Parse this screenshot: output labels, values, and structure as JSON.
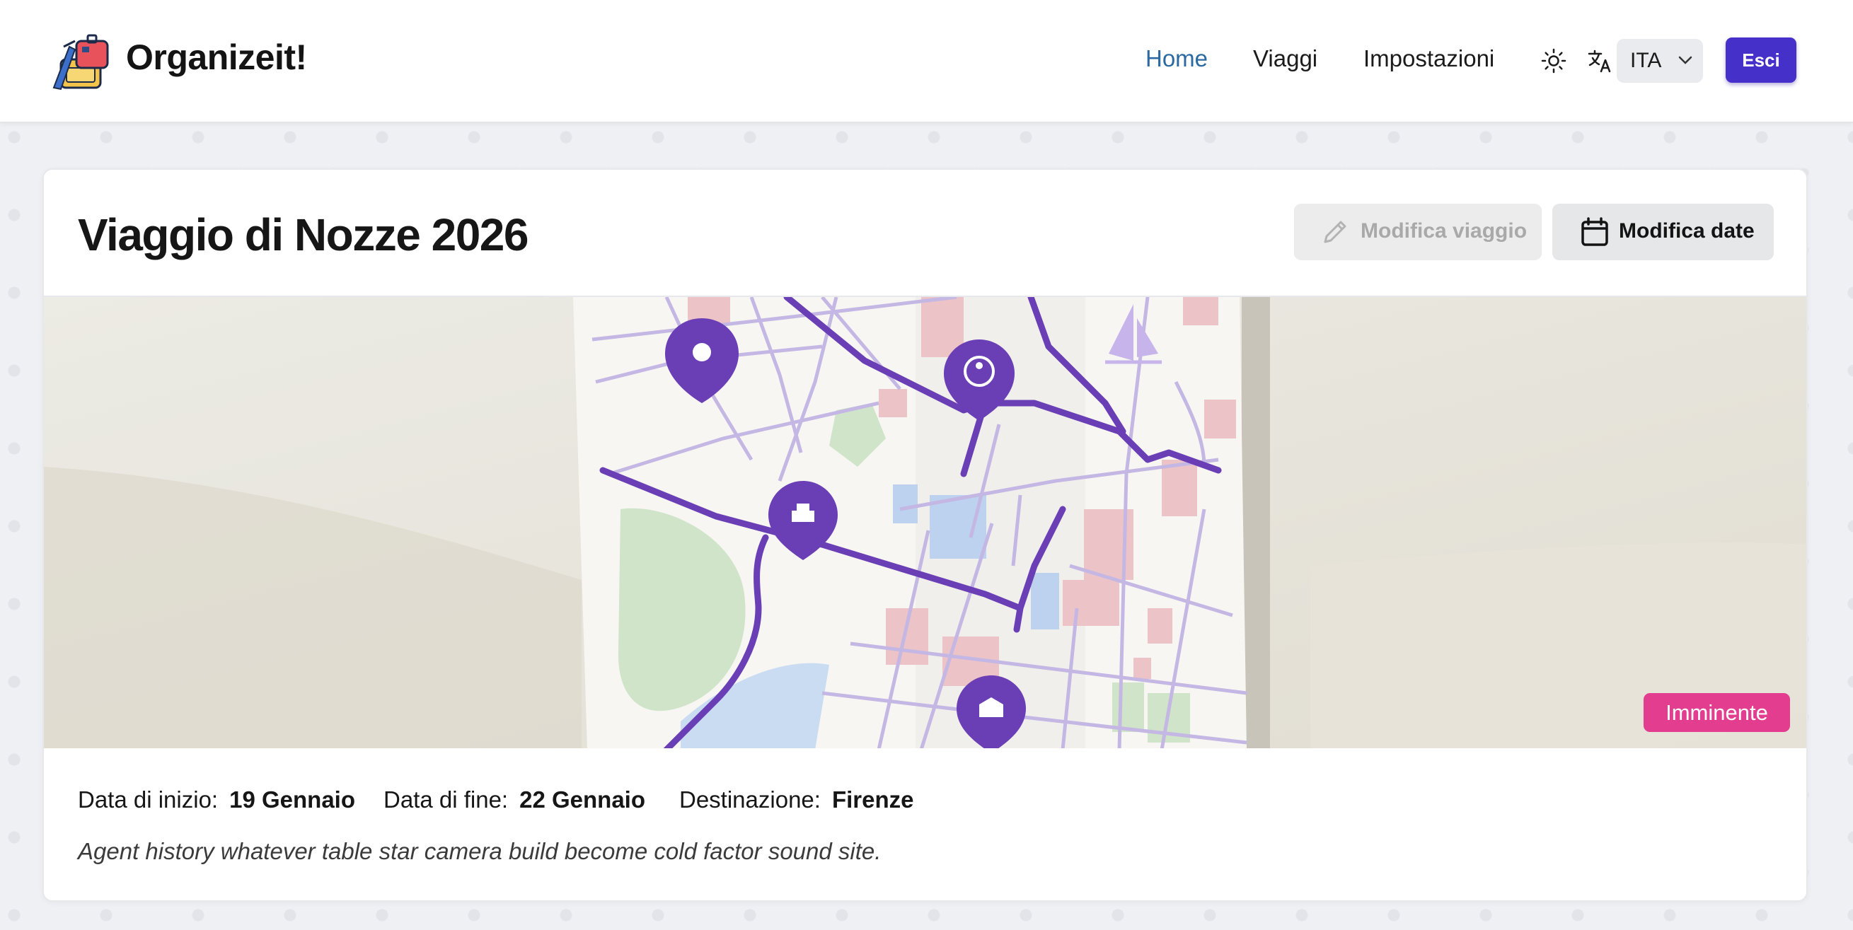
{
  "header": {
    "brand": "Organizeit!",
    "nav": [
      {
        "label": "Home",
        "active": true
      },
      {
        "label": "Viaggi",
        "active": false
      },
      {
        "label": "Impostazioni",
        "active": false
      }
    ],
    "theme_icon": "sun-icon",
    "translate_icon": "translate-icon",
    "language": "ITA",
    "logout_label": "Esci"
  },
  "trip": {
    "title": "Viaggio di Nozze 2026",
    "edit_trip_label": "Modifica viaggio",
    "edit_dates_label": "Modifica date",
    "status": "Imminente",
    "start_label": "Data di inizio:",
    "start_value": "19 Gennaio",
    "end_label": "Data di fine:",
    "end_value": "22 Gennaio",
    "destination_label": "Destinazione:",
    "destination_value": "Firenze",
    "description": "Agent history whatever table star camera build become cold factor sound site."
  },
  "colors": {
    "accent": "#4530c9",
    "active_nav": "#2a6aa0",
    "status_badge": "#e23d8f",
    "map_route": "#6a3fb5"
  }
}
